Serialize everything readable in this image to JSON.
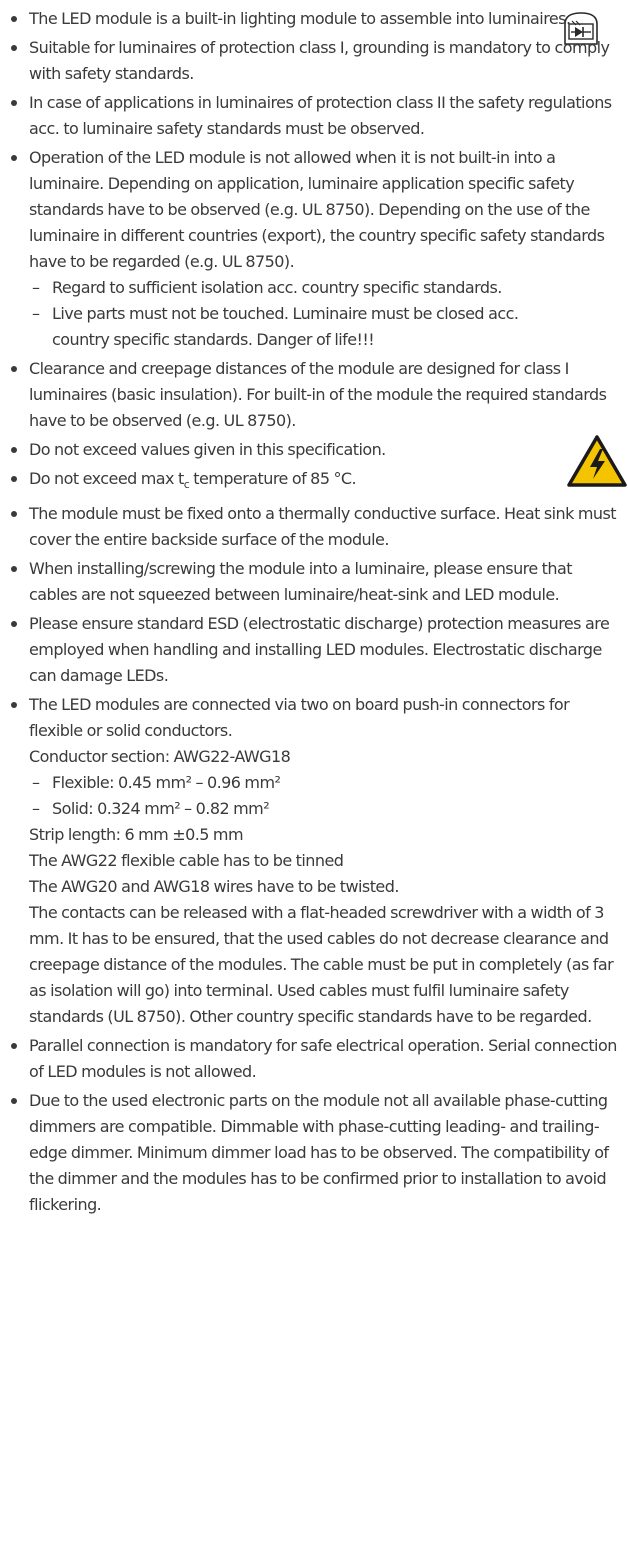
{
  "items": [
    {
      "text": "The LED module is a built-in lighting module to assemble into luminaires."
    },
    {
      "text": "Suitable for luminaires of protection class I, grounding is mandatory to comply with safety standards."
    },
    {
      "text": "In case of applications in luminaires of protection class II the safety regulations acc. to luminaire safety standards must be observed."
    },
    {
      "text": "Operation of the LED module is not allowed when it is not built-in into a luminaire. Depending on application, luminaire application specific safety standards have to be observed (e.g. UL 8750). Depending on the use of the luminaire in different countries (export), the country specific safety standards have to be regarded (e.g. UL 8750).",
      "sub": [
        "Regard to sufficient isolation acc. country specific standards.",
        "Live parts must not be touched. Luminaire must be closed acc. country specific standards. Danger of life!!!"
      ]
    },
    {
      "text": "Clearance and creepage distances of the module are designed for class I luminaires (basic insulation). For built-in of the module the required standards have to be observed (e.g. UL 8750)."
    },
    {
      "text": "Do not exceed values given in this specification."
    },
    {
      "text_pre": "Do not exceed max t",
      "text_sub": "c",
      "text_post": " temperature of 85 °C."
    },
    {
      "text": "The module must be fixed onto a thermally conductive surface. Heat sink must cover the entire backside surface of the module."
    },
    {
      "text": "When installing/screwing the module into a luminaire, please ensure that cables are not squeezed between luminaire/heat-sink and LED module."
    },
    {
      "text": "Please ensure standard ESD (electrostatic discharge) protection measures are employed when handling and installing LED modules. Electrostatic discharge can damage LEDs."
    },
    {
      "text": "The LED modules are connected via two on board push-in connectors for flexible or solid conductors.",
      "conductor_section": "Conductor section: AWG22-AWG18",
      "flexible": "Flexible: 0.45 mm² – 0.96 mm²",
      "solid": "Solid: 0.324 mm² – 0.82 mm²",
      "strip_length": "Strip length: 6 mm ±0.5 mm",
      "tinned": "The AWG22 flexible cable has to be tinned",
      "twisted": "The AWG20 and AWG18 wires have to be twisted.",
      "release": "The contacts can be released with a flat-headed screwdriver with a width of 3 mm. It has to be ensured, that the used cables do not decrease clearance and creepage distance of the modules. The cable must be put in completely (as far as isolation will go) into terminal. Used cables must fulfil luminaire safety standards (UL 8750). Other country specific standards have to be regarded."
    },
    {
      "text": "Parallel connection is mandatory for safe electrical operation. Serial connection of LED modules is not allowed."
    },
    {
      "text": "Due to the used electronic parts on the module not all available phase-cutting dimmers are compatible. Dimmable with phase-cutting leading- and trailing-edge dimmer. Minimum dimmer load has to be observed. The compatibility of the dimmer and the modules has to be confirmed prior to installation to avoid flickering."
    }
  ],
  "dash": "–",
  "colors": {
    "text": "#3a3a3a",
    "warning_fill": "#f5c400",
    "warning_stroke": "#1a1a1a"
  },
  "icons": {
    "top_right": "built-in-luminaire-led-symbol-icon",
    "warning": "high-voltage-warning-icon"
  }
}
